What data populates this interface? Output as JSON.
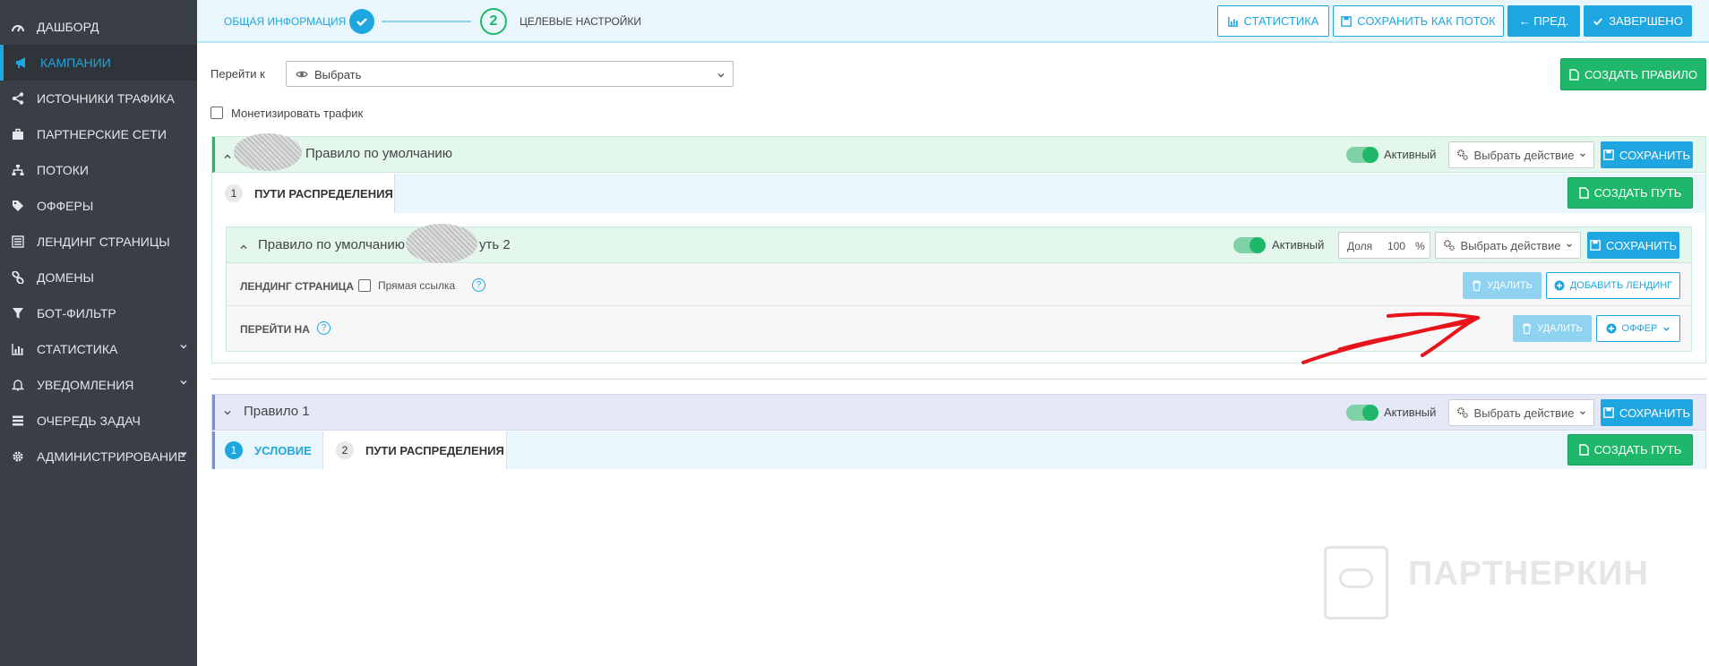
{
  "sidebar": {
    "items": [
      {
        "label": "ДАШБОРД",
        "icon": "dashboard-icon"
      },
      {
        "label": "КАМПАНИИ",
        "icon": "megaphone-icon",
        "active": true
      },
      {
        "label": "ИСТОЧНИКИ ТРАФИКА",
        "icon": "share-icon"
      },
      {
        "label": "ПАРТНЕРСКИЕ СЕТИ",
        "icon": "briefcase-icon"
      },
      {
        "label": "ПОТОКИ",
        "icon": "sitemap-icon"
      },
      {
        "label": "ОФФЕРЫ",
        "icon": "tags-icon"
      },
      {
        "label": "ЛЕНДИНГ СТРАНИЦЫ",
        "icon": "list-icon"
      },
      {
        "label": "ДОМЕНЫ",
        "icon": "link-icon"
      },
      {
        "label": "БОТ-ФИЛЬТР",
        "icon": "filter-icon"
      },
      {
        "label": "СТАТИСТИКА",
        "icon": "bar-chart-icon",
        "has_submenu": true
      },
      {
        "label": "УВЕДОМЛЕНИЯ",
        "icon": "bell-icon",
        "has_submenu": true
      },
      {
        "label": "ОЧЕРЕДЬ ЗАДАЧ",
        "icon": "queue-icon"
      },
      {
        "label": "АДМИНИСТРИРОВАНИЕ",
        "icon": "gear-icon",
        "has_submenu": true
      }
    ]
  },
  "wizard": {
    "step1_label": "ОБЩАЯ ИНФОРМАЦИЯ",
    "step2_number": "2",
    "step2_label": "ЦЕЛЕВЫЕ НАСТРОЙКИ"
  },
  "toolbar": {
    "stats": "СТАТИСТИКА",
    "save_as_flow": "СОХРАНИТЬ КАК ПОТОК",
    "prev": "← ПРЕД.",
    "finish": "ЗАВЕРШЕНО"
  },
  "goto": {
    "label": "Перейти к",
    "select_value": "Выбрать"
  },
  "create_rule": "СОЗДАТЬ ПРАВИЛО",
  "monetize": {
    "label": "Монетизировать трафик",
    "checked": false
  },
  "rule_default": {
    "title": "Правило по умолчанию",
    "status": "Активный",
    "action": "Выбрать действие",
    "save": "СОХРАНИТЬ",
    "tab_number": "1",
    "tab_label": "ПУТИ РАСПРЕДЕЛЕНИЯ",
    "create_path": "СОЗДАТЬ ПУТЬ",
    "path": {
      "title_prefix": "Правило по умолчанию",
      "title_suffix": "уть 2",
      "status": "Активный",
      "share_label": "Доля",
      "share_value": "100",
      "share_unit": "%",
      "action": "Выбрать действие",
      "save": "СОХРАНИТЬ",
      "landing_label": "ЛЕНДИНГ СТРАНИЦА",
      "direct_link": "Прямая ссылка",
      "delete": "УДАЛИТЬ",
      "add_landing": "ДОБАВИТЬ ЛЕНДИНГ",
      "goto_label": "ПЕРЕЙТИ НА",
      "delete2": "УДАЛИТЬ",
      "offer": "ОФФЕР"
    }
  },
  "rule1": {
    "title": "Правило 1",
    "status": "Активный",
    "action": "Выбрать действие",
    "save": "СОХРАНИТЬ",
    "tab1_number": "1",
    "tab1_label": "УСЛОВИЕ",
    "tab2_number": "2",
    "tab2_label": "ПУТИ РАСПРЕДЕЛЕНИЯ",
    "create_path": "СОЗДАТЬ ПУТЬ"
  },
  "watermark": "ПАРТНЕРКИН",
  "colors": {
    "accent": "#1ea6e0",
    "success": "#1fb86a",
    "sidebar": "#3a3f47",
    "annotation": "#e8141c"
  }
}
